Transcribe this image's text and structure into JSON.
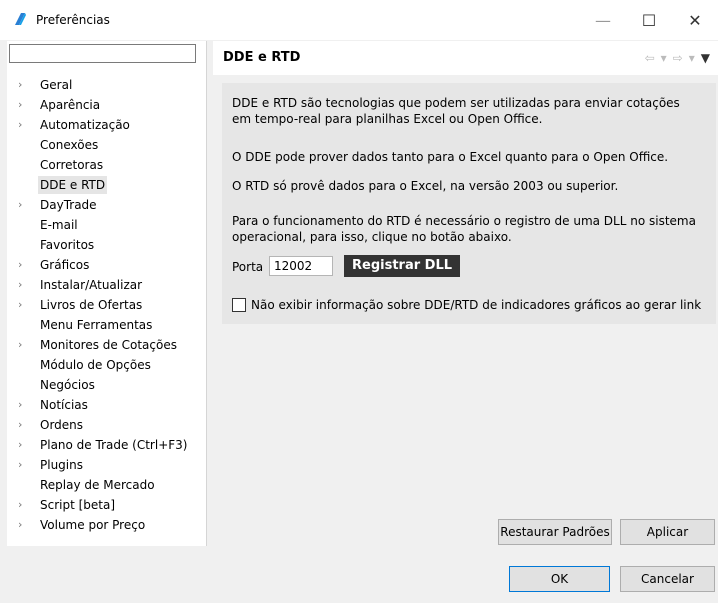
{
  "window": {
    "title": "Preferências",
    "minimize_icon": "minimize-icon",
    "maximize_icon": "maximize-icon",
    "close_icon": "close-icon"
  },
  "filter": {
    "value": "",
    "placeholder": ""
  },
  "tree": {
    "items": [
      {
        "label": "Geral",
        "expandable": true
      },
      {
        "label": "Aparência",
        "expandable": true
      },
      {
        "label": "Automatização",
        "expandable": true
      },
      {
        "label": "Conexões",
        "expandable": false
      },
      {
        "label": "Corretoras",
        "expandable": false
      },
      {
        "label": "DDE e RTD",
        "expandable": false,
        "selected": true
      },
      {
        "label": "DayTrade",
        "expandable": true
      },
      {
        "label": "E-mail",
        "expandable": false
      },
      {
        "label": "Favoritos",
        "expandable": false
      },
      {
        "label": "Gráficos",
        "expandable": true
      },
      {
        "label": "Instalar/Atualizar",
        "expandable": true
      },
      {
        "label": "Livros de Ofertas",
        "expandable": true
      },
      {
        "label": "Menu Ferramentas",
        "expandable": false
      },
      {
        "label": "Monitores de Cotações",
        "expandable": true
      },
      {
        "label": "Módulo de Opções",
        "expandable": false
      },
      {
        "label": "Negócios",
        "expandable": false
      },
      {
        "label": "Notícias",
        "expandable": true
      },
      {
        "label": "Ordens",
        "expandable": true
      },
      {
        "label": "Plano de Trade (Ctrl+F3)",
        "expandable": true
      },
      {
        "label": "Plugins",
        "expandable": true
      },
      {
        "label": "Replay de Mercado",
        "expandable": false
      },
      {
        "label": "Script [beta]",
        "expandable": true
      },
      {
        "label": "Volume por Preço",
        "expandable": true
      }
    ]
  },
  "page": {
    "title": "DDE e RTD",
    "paragraphs": [
      "DDE e RTD são tecnologias que podem ser utilizadas para enviar cotações em tempo-real para planilhas Excel ou Open Office.",
      "O DDE pode prover dados tanto para o Excel quanto para o Open Office.",
      "O RTD só provê dados para o Excel, na versão 2003 ou superior.",
      "Para o funcionamento do RTD é necessário o registro de uma DLL no sistema operacional, para isso, clique no botão abaixo."
    ],
    "porta_label": "Porta",
    "porta_value": "12002",
    "register_button": "Registrar DLL",
    "checkbox_label": "Não exibir informação sobre DDE/RTD de indicadores gráficos ao gerar link",
    "checkbox_checked": false
  },
  "buttons": {
    "restore": "Restaurar Padrões",
    "apply": "Aplicar",
    "ok": "OK",
    "cancel": "Cancelar"
  },
  "colors": {
    "register_button_bg": "#333333",
    "content_bg": "#e6e6e6",
    "ok_border": "#0078d7"
  }
}
